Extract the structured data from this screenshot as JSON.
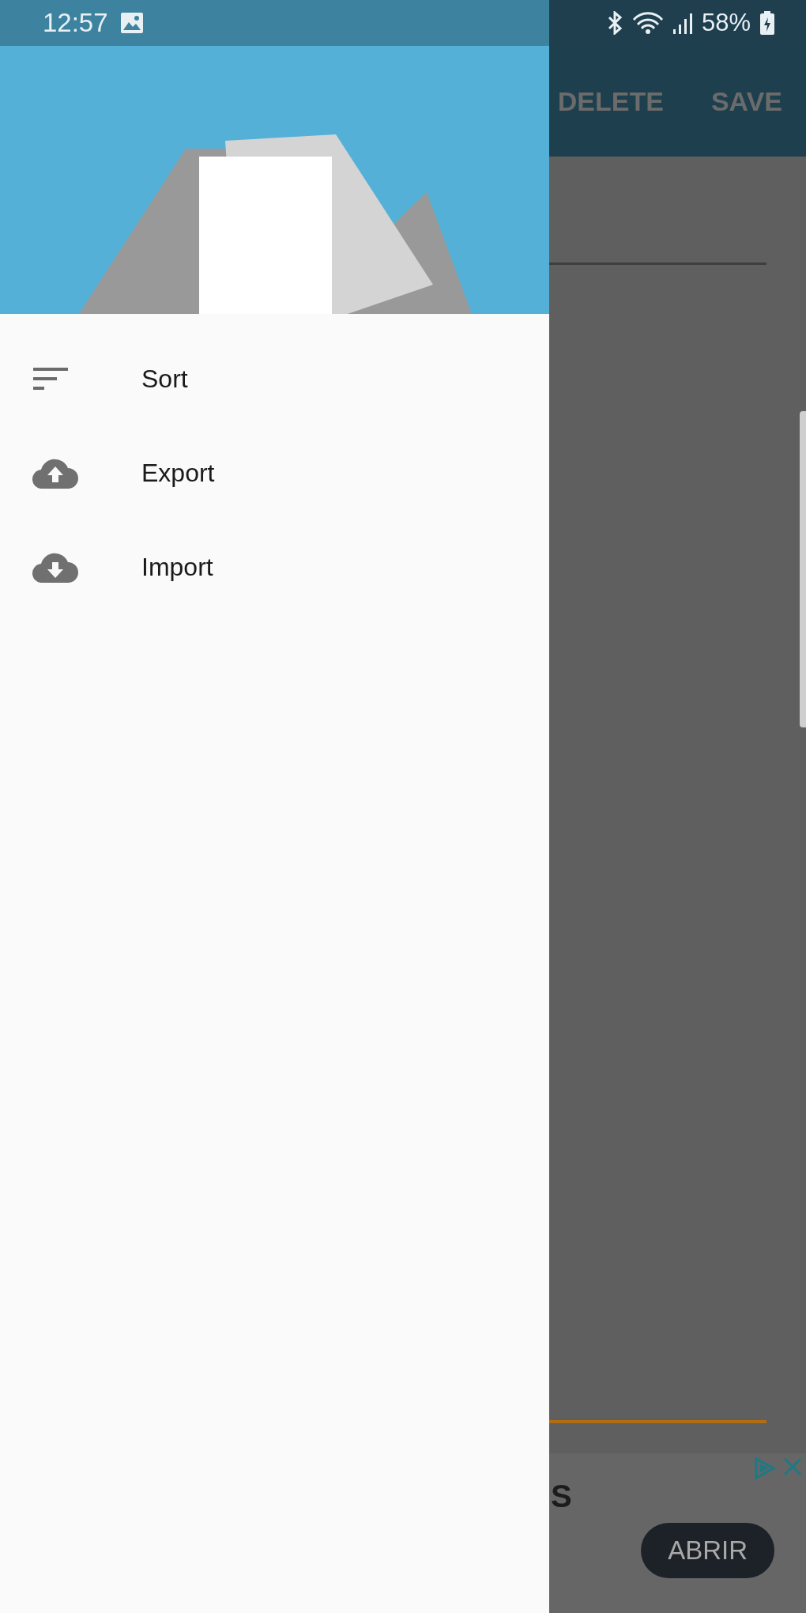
{
  "status_bar": {
    "time": "12:57",
    "battery": "58%"
  },
  "toolbar": {
    "actions": [
      "DELETE",
      "SAVE"
    ]
  },
  "drawer": {
    "items": [
      {
        "label": "Sort",
        "kind": "sort"
      },
      {
        "label": "Export",
        "kind": "upload"
      },
      {
        "label": "Import",
        "kind": "download"
      }
    ]
  },
  "ad": {
    "title": "S",
    "button": "ABRIR"
  }
}
